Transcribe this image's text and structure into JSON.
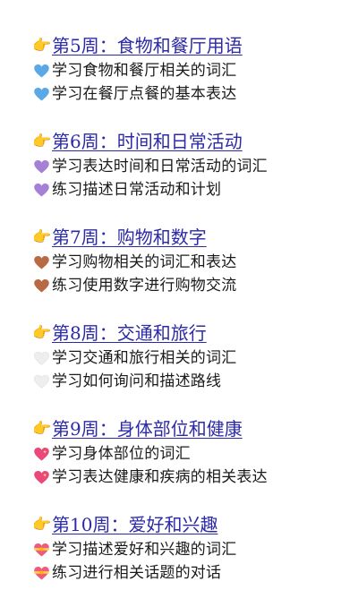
{
  "weeks": [
    {
      "title": "第5周：食物和餐厅用语",
      "pointer_icon": "backhand-index-pointing-right",
      "heart_icon": "blue-heart",
      "heart_color": "#5aa9e6",
      "items": [
        "学习食物和餐厅相关的词汇",
        "学习在餐厅点餐的基本表达"
      ]
    },
    {
      "title": "第6周：时间和日常活动",
      "pointer_icon": "backhand-index-pointing-right",
      "heart_icon": "purple-heart",
      "heart_color": "#a67fd6",
      "items": [
        "学习表达时间和日常活动的词汇",
        "练习描述日常活动和计划"
      ]
    },
    {
      "title": "第7周：购物和数字",
      "pointer_icon": "backhand-index-pointing-right",
      "heart_icon": "brown-heart",
      "heart_color": "#b86a45",
      "items": [
        "学习购物相关的词汇和表达",
        "练习使用数字进行购物交流"
      ]
    },
    {
      "title": "第8周：交通和旅行",
      "pointer_icon": "backhand-index-pointing-right",
      "heart_icon": "white-heart",
      "heart_color": "#eeeeee",
      "items": [
        "学习交通和旅行相关的词汇",
        "学习如何询问和描述路线"
      ]
    },
    {
      "title": "第9周：身体部位和健康",
      "pointer_icon": "backhand-index-pointing-right",
      "heart_icon": "sparkling-heart",
      "heart_color": "#e8497a",
      "items": [
        "学习身体部位的词汇",
        "学习表达健康和疾病的相关表达"
      ]
    },
    {
      "title": "第10周：爱好和兴趣",
      "pointer_icon": "backhand-index-pointing-right",
      "heart_icon": "heart-with-ribbon",
      "heart_color": "#f05a7e",
      "items": [
        "学习描述爱好和兴趣的词汇",
        "练习进行相关话题的对话"
      ]
    }
  ]
}
